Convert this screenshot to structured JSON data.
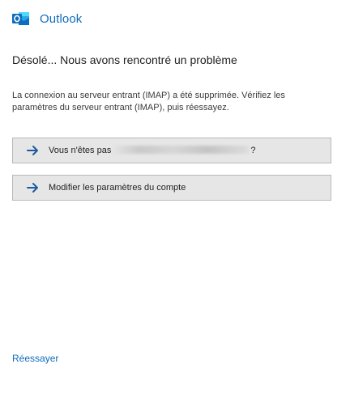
{
  "header": {
    "app_name": "Outlook",
    "logo_icon": "outlook-logo-icon"
  },
  "error": {
    "title": "Désolé... Nous avons rencontré un problème",
    "message": "La connexion au serveur entrant (IMAP) a été supprimée. Vérifiez les paramètres du serveur entrant (IMAP), puis réessayez."
  },
  "actions": [
    {
      "icon": "arrow-right-icon",
      "label_prefix": "Vous n'êtes pas",
      "label_suffix": "?"
    },
    {
      "icon": "arrow-right-icon",
      "label": "Modifier les paramètres du compte"
    }
  ],
  "footer": {
    "retry_label": "Réessayer"
  },
  "colors": {
    "accent": "#0f6cbd",
    "button_bg": "#e6e6e6",
    "button_border": "#b9b9b9",
    "arrow": "#1f5a9e"
  }
}
